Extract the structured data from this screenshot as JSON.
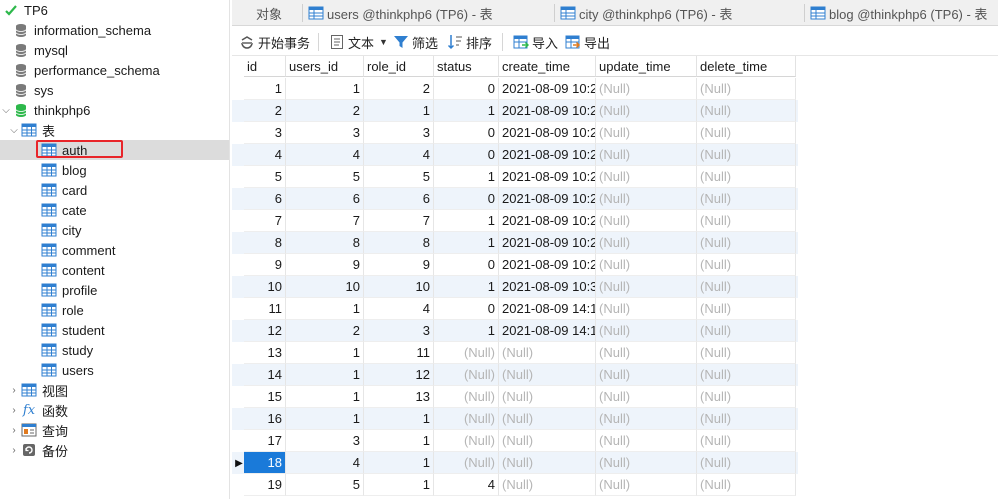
{
  "sidebar": {
    "connection": "TP6",
    "databases": [
      "information_schema",
      "mysql",
      "performance_schema",
      "sys",
      "thinkphp6"
    ],
    "tables_label": "表",
    "tables": [
      "auth",
      "blog",
      "card",
      "cate",
      "city",
      "comment",
      "content",
      "profile",
      "role",
      "student",
      "study",
      "users"
    ],
    "selected_table": "auth",
    "groups": [
      "视图",
      "函数",
      "查询",
      "备份"
    ]
  },
  "tabs": {
    "objects": "对象",
    "items": [
      "users @thinkphp6 (TP6) - 表",
      "city @thinkphp6 (TP6) - 表",
      "blog @thinkphp6 (TP6) - 表"
    ]
  },
  "toolbar": {
    "begin_transaction": "开始事务",
    "text": "文本",
    "filter": "筛选",
    "sort": "排序",
    "import": "导入",
    "export": "导出"
  },
  "grid": {
    "columns": [
      "id",
      "users_id",
      "role_id",
      "status",
      "create_time",
      "update_time",
      "delete_time"
    ],
    "rows": [
      [
        "1",
        "1",
        "2",
        "0",
        "2021-08-09 10:2",
        "(Null)",
        "(Null)"
      ],
      [
        "2",
        "2",
        "1",
        "1",
        "2021-08-09 10:2",
        "(Null)",
        "(Null)"
      ],
      [
        "3",
        "3",
        "3",
        "0",
        "2021-08-09 10:2",
        "(Null)",
        "(Null)"
      ],
      [
        "4",
        "4",
        "4",
        "0",
        "2021-08-09 10:2",
        "(Null)",
        "(Null)"
      ],
      [
        "5",
        "5",
        "5",
        "1",
        "2021-08-09 10:2",
        "(Null)",
        "(Null)"
      ],
      [
        "6",
        "6",
        "6",
        "0",
        "2021-08-09 10:2",
        "(Null)",
        "(Null)"
      ],
      [
        "7",
        "7",
        "7",
        "1",
        "2021-08-09 10:2",
        "(Null)",
        "(Null)"
      ],
      [
        "8",
        "8",
        "8",
        "1",
        "2021-08-09 10:2",
        "(Null)",
        "(Null)"
      ],
      [
        "9",
        "9",
        "9",
        "0",
        "2021-08-09 10:2",
        "(Null)",
        "(Null)"
      ],
      [
        "10",
        "10",
        "10",
        "1",
        "2021-08-09 10:3",
        "(Null)",
        "(Null)"
      ],
      [
        "11",
        "1",
        "4",
        "0",
        "2021-08-09 14:1",
        "(Null)",
        "(Null)"
      ],
      [
        "12",
        "2",
        "3",
        "1",
        "2021-08-09 14:1",
        "(Null)",
        "(Null)"
      ],
      [
        "13",
        "1",
        "11",
        "(Null)",
        "(Null)",
        "(Null)",
        "(Null)"
      ],
      [
        "14",
        "1",
        "12",
        "(Null)",
        "(Null)",
        "(Null)",
        "(Null)"
      ],
      [
        "15",
        "1",
        "13",
        "(Null)",
        "(Null)",
        "(Null)",
        "(Null)"
      ],
      [
        "16",
        "1",
        "1",
        "(Null)",
        "(Null)",
        "(Null)",
        "(Null)"
      ],
      [
        "17",
        "3",
        "1",
        "(Null)",
        "(Null)",
        "(Null)",
        "(Null)"
      ],
      [
        "18",
        "4",
        "1",
        "(Null)",
        "(Null)",
        "(Null)",
        "(Null)"
      ],
      [
        "19",
        "5",
        "1",
        "4",
        "(Null)",
        "(Null)",
        "(Null)"
      ]
    ],
    "current_row": 18
  },
  "colors": {
    "selection": "#1a7ad9",
    "highlight_box": "#e8252a",
    "alt_row": "#eef4fb",
    "null_text": "#b5b5b5",
    "db_active": "#2db84b",
    "db_inactive": "#7a7a7a",
    "table_icon": "#2f7fd0"
  }
}
